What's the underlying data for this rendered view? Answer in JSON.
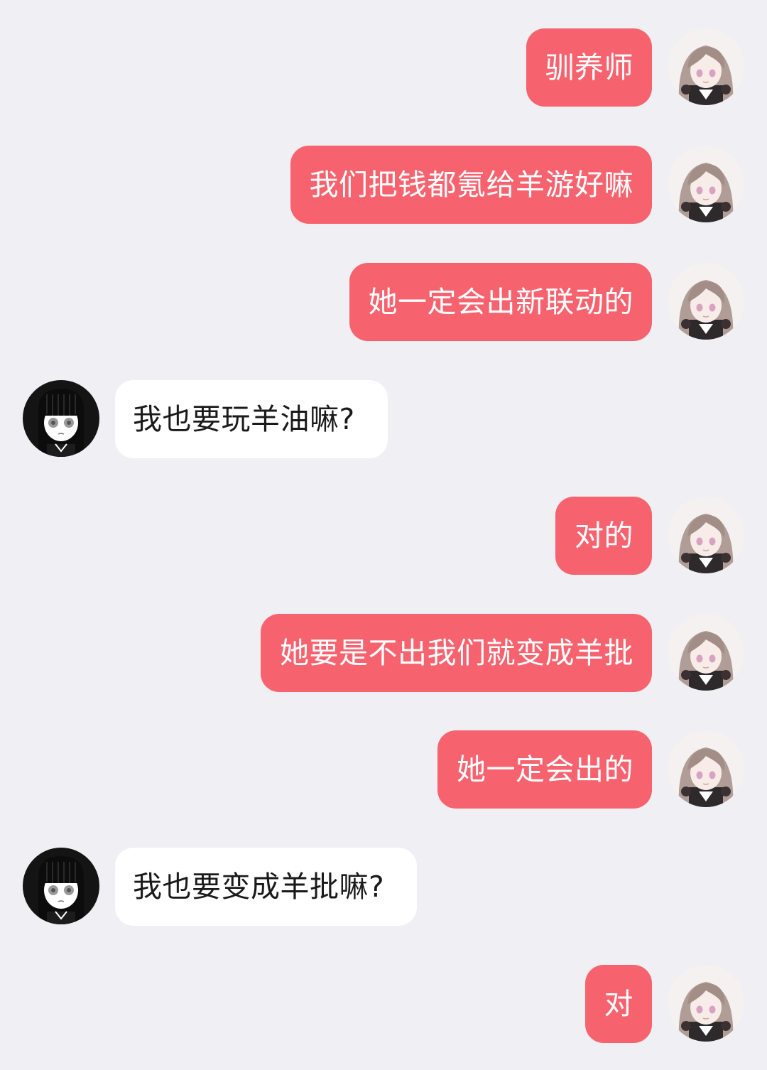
{
  "messages": [
    {
      "side": "out",
      "text": "驯养师",
      "avatar": "pink-haired-girl-avatar"
    },
    {
      "side": "out",
      "text": "我们把钱都氪给羊游好嘛",
      "avatar": "pink-haired-girl-avatar"
    },
    {
      "side": "out",
      "text": "她一定会出新联动的",
      "avatar": "pink-haired-girl-avatar"
    },
    {
      "side": "in",
      "text": "我也要玩羊油嘛?",
      "avatar": "black-haired-girl-avatar"
    },
    {
      "side": "out",
      "text": "对的",
      "avatar": "pink-haired-girl-avatar"
    },
    {
      "side": "out",
      "text": "她要是不出我们就变成羊批",
      "avatar": "pink-haired-girl-avatar"
    },
    {
      "side": "out",
      "text": "她一定会出的",
      "avatar": "pink-haired-girl-avatar"
    },
    {
      "side": "in",
      "text": "我也要变成羊批嘛?",
      "avatar": "black-haired-girl-avatar"
    },
    {
      "side": "out",
      "text": "对",
      "avatar": "pink-haired-girl-avatar"
    }
  ],
  "colors": {
    "background": "#efeff4",
    "outgoing_bubble": "#f6636f",
    "incoming_bubble": "#ffffff",
    "outgoing_text": "#ffffff",
    "incoming_text": "#1a1a1a"
  }
}
